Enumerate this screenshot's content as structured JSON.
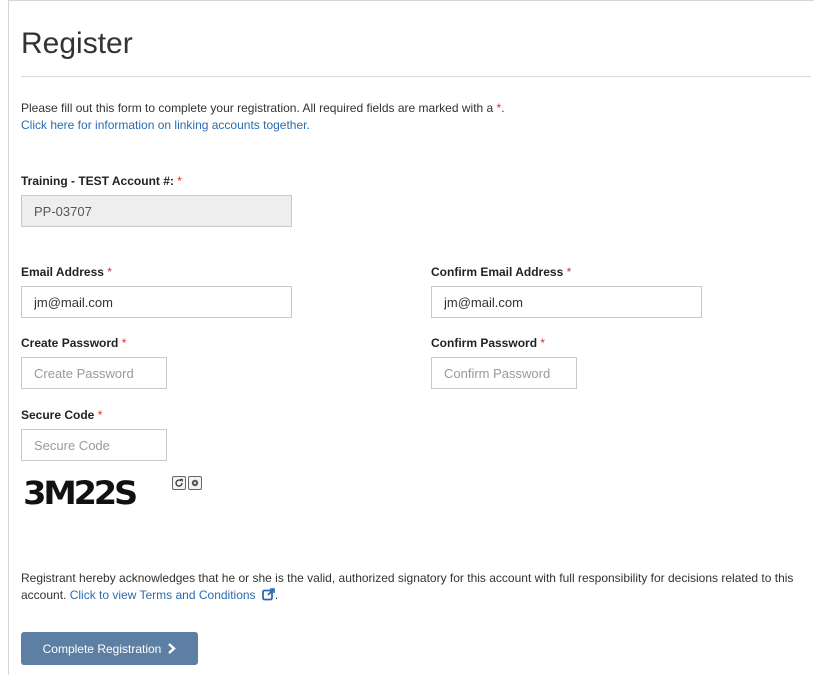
{
  "page": {
    "title": "Register"
  },
  "intro": {
    "text": "Please fill out this form to complete your registration. All required fields are marked with a ",
    "required_marker": "*",
    "period": ".",
    "link_text": "Click here for information on linking accounts together."
  },
  "fields": {
    "account": {
      "label": "Training - TEST Account #:",
      "required_marker": "*",
      "value": "PP-03707"
    },
    "email": {
      "label": "Email Address",
      "required_marker": "*",
      "value": "jm@mail.com"
    },
    "confirm_email": {
      "label": "Confirm Email Address",
      "required_marker": "*",
      "value": "jm@mail.com"
    },
    "password": {
      "label": "Create Password",
      "required_marker": "*",
      "value": "",
      "placeholder": "Create Password"
    },
    "confirm_password": {
      "label": "Confirm Password",
      "required_marker": "*",
      "value": "",
      "placeholder": "Confirm Password"
    },
    "secure_code": {
      "label": "Secure Code",
      "required_marker": "*",
      "value": "",
      "placeholder": "Secure Code"
    }
  },
  "captcha": {
    "text": "3M22S",
    "refresh_icon": "refresh-icon",
    "audio_icon": "audio-icon"
  },
  "terms": {
    "text": "Registrant hereby acknowledges that he or she is the valid, authorized signatory for this account with full responsibility for decisions related to this account. ",
    "link_text": "Click to view Terms and Conditions",
    "link_icon": "external-link-icon",
    "period": "."
  },
  "submit": {
    "label": "Complete Registration",
    "icon": "chevron-right-icon"
  },
  "colors": {
    "link": "#2a6cb0",
    "required": "#e12a2a",
    "button": "#5d7fa3"
  }
}
